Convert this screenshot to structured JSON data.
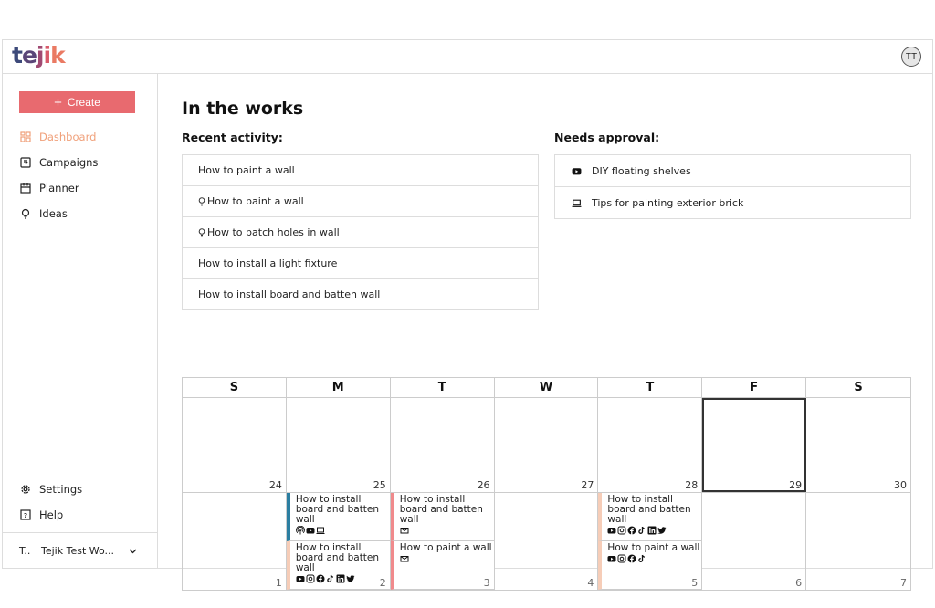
{
  "app": {
    "name": "tejik",
    "logo_letters": [
      "t",
      "e",
      "j",
      "i",
      "k"
    ],
    "logo_colors": [
      "#3d4a7a",
      "#5a4678",
      "#a04a72",
      "#d85a6a",
      "#ea7a63"
    ],
    "accent": "#e86a6f",
    "active_nav_color": "#f0a07a"
  },
  "topbar": {
    "avatar_initials": "TT"
  },
  "sidebar": {
    "create_label": "Create",
    "items": [
      {
        "label": "Dashboard",
        "icon": "dashboard-icon",
        "active": true
      },
      {
        "label": "Campaigns",
        "icon": "campaigns-icon",
        "active": false
      },
      {
        "label": "Planner",
        "icon": "calendar-icon",
        "active": false
      },
      {
        "label": "Ideas",
        "icon": "lightbulb-icon",
        "active": false
      }
    ],
    "bottom_items": [
      {
        "label": "Settings",
        "icon": "gear-icon"
      },
      {
        "label": "Help",
        "icon": "help-icon"
      }
    ],
    "workspace": {
      "abbr": "T..",
      "name": "Tejik Test Wo..."
    }
  },
  "main": {
    "title": "In the works",
    "recent_activity": {
      "heading": "Recent activity:",
      "items": [
        {
          "label": "How to paint a wall",
          "idea": false
        },
        {
          "label": "How to paint a wall",
          "idea": true
        },
        {
          "label": "How to patch holes in wall",
          "idea": true
        },
        {
          "label": "How to install a light fixture",
          "idea": false
        },
        {
          "label": "How to install board and batten wall",
          "idea": false
        }
      ]
    },
    "needs_approval": {
      "heading": "Needs approval:",
      "items": [
        {
          "label": "DIY floating shelves",
          "icon": "youtube-icon"
        },
        {
          "label": "Tips for painting exterior brick",
          "icon": "laptop-icon"
        }
      ]
    },
    "calendar": {
      "days": [
        "S",
        "M",
        "T",
        "W",
        "T",
        "F",
        "S"
      ],
      "weeks": [
        [
          {
            "num": "24",
            "events": []
          },
          {
            "num": "25",
            "events": []
          },
          {
            "num": "26",
            "events": []
          },
          {
            "num": "27",
            "events": []
          },
          {
            "num": "28",
            "events": []
          },
          {
            "num": "29",
            "today": true,
            "events": []
          },
          {
            "num": "30",
            "events": []
          }
        ],
        [
          {
            "num": "1",
            "events": []
          },
          {
            "num": "2",
            "events": [
              {
                "title": "How to install board and batten wall",
                "color": "#2b7ea1",
                "icons": [
                  "podcast",
                  "youtube",
                  "laptop"
                ]
              },
              {
                "title": "How to install board and batten wall",
                "color": "#f6cdb8",
                "icons": [
                  "youtube",
                  "instagram",
                  "facebook",
                  "tiktok",
                  "linkedin",
                  "twitter"
                ]
              }
            ]
          },
          {
            "num": "3",
            "events": [
              {
                "title": "How to install board and batten wall",
                "color": "#f08a8c",
                "icons": [
                  "email"
                ]
              },
              {
                "title": "How to paint a wall",
                "color": "#f08a8c",
                "icons": [
                  "email"
                ]
              }
            ]
          },
          {
            "num": "4",
            "events": []
          },
          {
            "num": "5",
            "events": [
              {
                "title": "How to install board and batten wall",
                "color": "#f6cdb8",
                "icons": [
                  "youtube",
                  "instagram",
                  "facebook",
                  "tiktok",
                  "linkedin",
                  "twitter"
                ]
              },
              {
                "title": "How to paint a wall",
                "color": "#f6cdb8",
                "icons": [
                  "youtube",
                  "instagram",
                  "facebook",
                  "tiktok"
                ]
              }
            ]
          },
          {
            "num": "6",
            "events": []
          },
          {
            "num": "7",
            "events": []
          }
        ]
      ]
    }
  }
}
